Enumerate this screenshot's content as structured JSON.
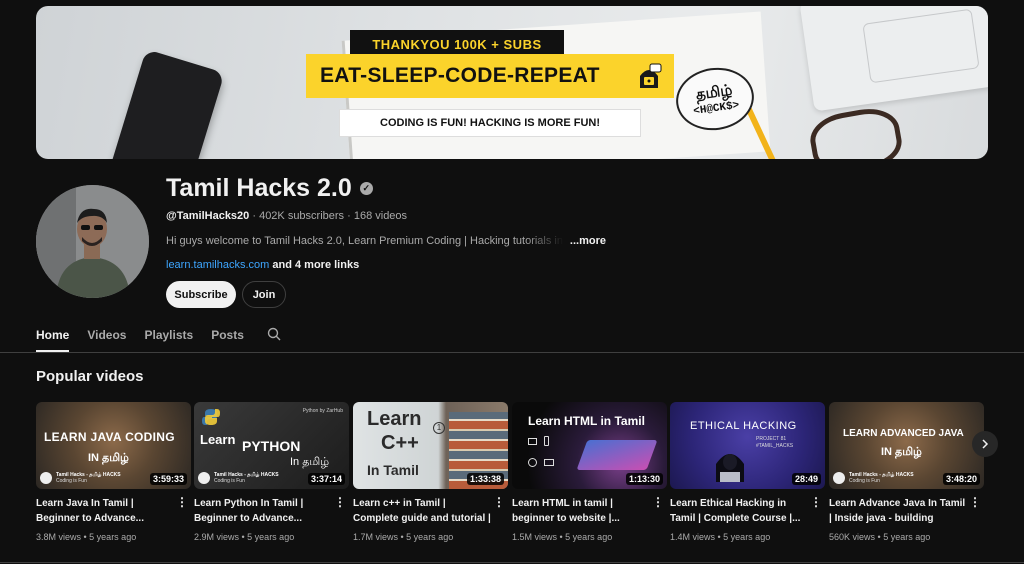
{
  "banner": {
    "tag1": "THANKYOU 100K + SUBS",
    "tag2": "EAT-SLEEP-CODE-REPEAT",
    "tag3": "CODING IS FUN! HACKING IS MORE FUN!",
    "logo_line1": "தமிழ்",
    "logo_line2": "<H@CK$>"
  },
  "channel": {
    "name": "Tamil Hacks 2.0",
    "handle": "@TamilHacks20",
    "stats": " · 402K subscribers · 168 videos",
    "description": "Hi guys welcome to Tamil Hacks 2.0, Learn Premium Coding | Hacking tutorials in Tamil",
    "more": "...more",
    "link": "learn.tamilhacks.com",
    "more_links": " and 4 more links",
    "subscribe_label": "Subscribe",
    "join_label": "Join"
  },
  "tabs": [
    {
      "label": "Home",
      "active": true
    },
    {
      "label": "Videos",
      "active": false
    },
    {
      "label": "Playlists",
      "active": false
    },
    {
      "label": "Posts",
      "active": false
    }
  ],
  "section_title": "Popular videos",
  "videos": [
    {
      "title": "Learn Java In Tamil | Beginner to Advance...",
      "views": "3.8M views",
      "age": "5 years ago",
      "duration": "3:59:33",
      "thumb_line1": "LEARN  JAVA CODING",
      "thumb_line2": "IN தமிழ்",
      "thumb_brand": "Tamil Hacks - தமிழ் HACKS",
      "thumb_tag": "Coding is Fun"
    },
    {
      "title": "Learn Python In Tamil | Beginner to Advance...",
      "views": "2.9M views",
      "age": "5 years ago",
      "duration": "3:37:14",
      "thumb_line1": "Learn",
      "thumb_line2": "PYTHON",
      "thumb_line3": "In தமிழ்",
      "thumb_brand": "Tamil Hacks - தமிழ் HACKS",
      "thumb_tag": "Coding is Fun",
      "thumb_corner": "Python by ZarHub"
    },
    {
      "title": "Learn c++ in Tamil | Complete guide and tutorial | Beginner...",
      "views": "1.7M views",
      "age": "5 years ago",
      "duration": "1:33:38",
      "thumb_line1": "Learn",
      "thumb_line2": "C++",
      "thumb_line3": "In Tamil"
    },
    {
      "title": "Learn HTML in tamil | beginner to website |...",
      "views": "1.5M views",
      "age": "5 years ago",
      "duration": "1:13:30",
      "thumb_line1": "Learn HTML in Tamil"
    },
    {
      "title": "Learn Ethical Hacking in Tamil | Complete Course |...",
      "views": "1.4M views",
      "age": "5 years ago",
      "duration": "28:49",
      "thumb_line1": "ETHICAL HACKING",
      "thumb_line2": "PROJECT 81",
      "thumb_line3": "#TAMIL_HACKS"
    },
    {
      "title": "Learn Advance Java In Tamil | Inside java - building blocks...",
      "views": "560K views",
      "age": "5 years ago",
      "duration": "3:48:20",
      "thumb_line1": "LEARN ADVANCED JAVA",
      "thumb_line2": "IN தமிழ்",
      "thumb_brand": "Tamil Hacks - தமிழ் HACKS",
      "thumb_tag": "Coding is Fun"
    }
  ]
}
